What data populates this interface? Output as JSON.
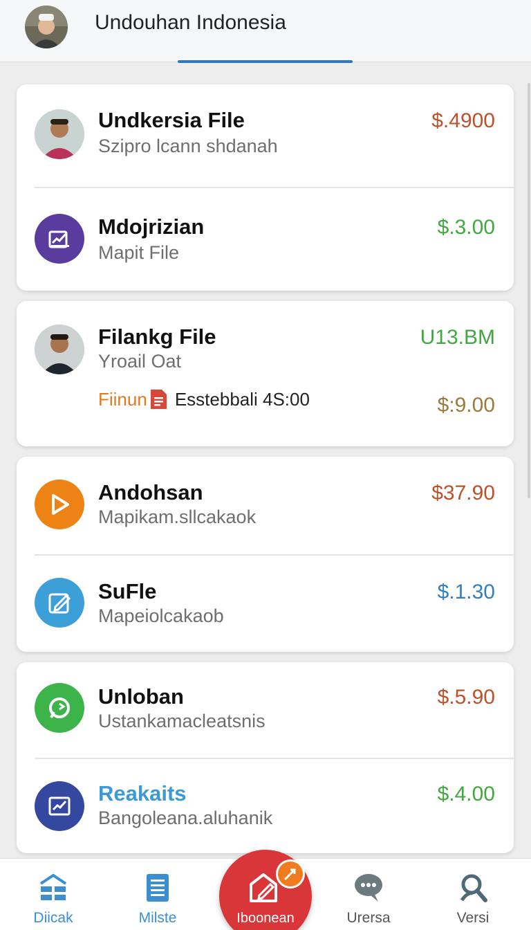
{
  "header": {
    "title": "Undouhan Indonesia",
    "avatar_icon": "user-avatar-icon"
  },
  "items": [
    {
      "name": "Undkersia File",
      "sub": "Szipro lcann shdanah",
      "price": "$.4900",
      "price_color": "#c0502a",
      "icon": "person-avatar-icon"
    },
    {
      "name": "Mdojrizian",
      "sub": "Mapit File",
      "price": "$.3.00",
      "price_color": "#3fa93f",
      "icon": "chart-edit-icon"
    },
    {
      "name": "Filankg File",
      "sub": "Yroail Oat",
      "price": "U13.BM",
      "price_color": "#3fa93f",
      "icon": "person-avatar-icon",
      "attach_label": "Fiinun",
      "attach_text": "Esstebbali 4S:00",
      "price2": "$:9.00",
      "price2_color": "#9a7b3c"
    },
    {
      "name": "Andohsan",
      "sub": "Mapikam.sllcakaok",
      "price": "$37.90",
      "price_color": "#c0502a",
      "icon": "play-icon"
    },
    {
      "name": "SuFle",
      "sub": "Mapeiolcakaob",
      "price": "$.1.30",
      "price_color": "#2f7fc1",
      "icon": "edit-icon"
    },
    {
      "name": "Unloban",
      "sub": "Ustankamacleatsnis",
      "price": "$.5.90",
      "price_color": "#c0502a",
      "icon": "refresh-chat-icon"
    },
    {
      "name": "Reakaits",
      "sub": "Bangoleana.aluhanik",
      "price": "$.4.00",
      "price_color": "#3fa93f",
      "icon": "chart-icon",
      "name_color": "#3b9ad6"
    }
  ],
  "nav": [
    {
      "label": "Diicak",
      "color": "#3b8fd0",
      "icon": "grid-home-icon"
    },
    {
      "label": "Milste",
      "color": "#3b8fd0",
      "icon": "list-icon"
    },
    {
      "label": "Iboonean",
      "color": "#ffffff",
      "icon": "edit-home-icon"
    },
    {
      "label": "Urersa",
      "color": "#555555",
      "icon": "chat-icon"
    },
    {
      "label": "Versi",
      "color": "#555555",
      "icon": "search-icon"
    }
  ]
}
